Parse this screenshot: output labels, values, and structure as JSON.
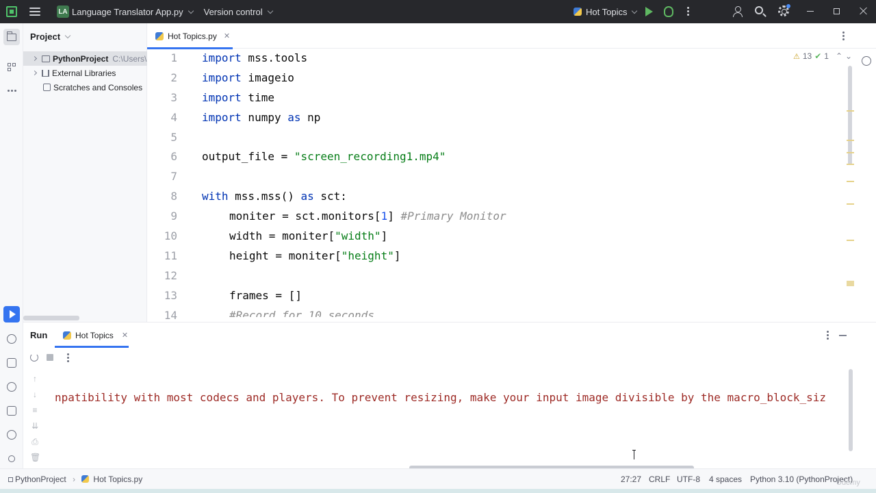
{
  "titlebar": {
    "project_badge": "LA",
    "project_name": "Language Translator App.py",
    "version_control": "Version control",
    "run_config": "Hot Topics",
    "icons": [
      "hamburger-icon",
      "run-icon",
      "debug-icon",
      "user-icon",
      "search-icon",
      "gear-icon"
    ]
  },
  "project_panel": {
    "title": "Project",
    "items": [
      {
        "label": "PythonProject",
        "path": "C:\\Users\\"
      },
      {
        "label": "External Libraries"
      },
      {
        "label": "Scratches and Consoles"
      }
    ]
  },
  "editor": {
    "tab_label": "Hot Topics.py",
    "inspection": {
      "warnings": "13",
      "ok": "1"
    },
    "line_numbers": [
      "1",
      "2",
      "3",
      "4",
      "5",
      "6",
      "7",
      "8",
      "9",
      "10",
      "11",
      "12",
      "13",
      "14"
    ],
    "code": {
      "l1_kw": "import",
      "l1_rest": " mss.tools",
      "l2_kw": "import",
      "l2_rest": " imageio",
      "l3_kw": "import",
      "l3_rest": " time",
      "l4_kw": "import",
      "l4_mid": " numpy ",
      "l4_as": "as",
      "l4_rest": " np",
      "l6_var": "output_file = ",
      "l6_str": "\"screen_recording1.mp4\"",
      "l8_kw": "with",
      "l8_mid": " mss.mss() ",
      "l8_as": "as",
      "l8_rest": " sct:",
      "l9_a": "moniter = sct.monitors[",
      "l9_num": "1",
      "l9_b": "] ",
      "l9_cmt": "#Primary Monitor",
      "l10_a": "width = moniter[",
      "l10_str": "\"width\"",
      "l10_b": "]",
      "l11_a": "height = moniter[",
      "l11_str": "\"height\"",
      "l11_b": "]",
      "l13": "frames = []",
      "l14_cmt": "#Record for 10 seconds"
    }
  },
  "run_panel": {
    "title": "Run",
    "tab_label": "Hot Topics",
    "console_text": "npatibility with most codecs and players. To prevent resizing, make your input image divisible by the macro_block_siz"
  },
  "statusbar": {
    "breadcrumb_project": "PythonProject",
    "breadcrumb_file": "Hot Topics.py",
    "position": "27:27",
    "line_sep": "CRLF",
    "encoding": "UTF-8",
    "indent": "4 spaces",
    "interpreter": "Python 3.10 (PythonProject)"
  },
  "watermark": "Udemy",
  "colors": {
    "titlebar_bg": "#27282c",
    "accent": "#3574f0",
    "keyword": "#0033b3",
    "string": "#067d17",
    "console_error": "#9d2a25"
  }
}
